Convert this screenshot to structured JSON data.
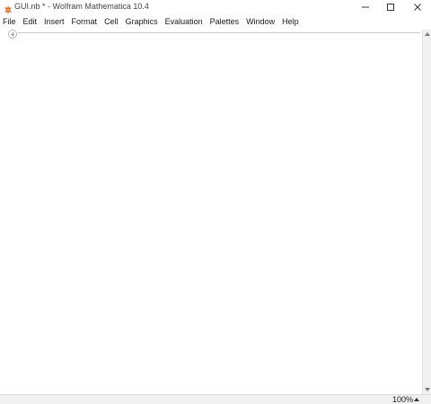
{
  "window": {
    "title": "GUI.nb * - Wolfram Mathematica 10.4",
    "icon": "mathematica-spiky-icon",
    "accent_color": "#e8591a"
  },
  "menubar": {
    "items": [
      "File",
      "Edit",
      "Insert",
      "Format",
      "Cell",
      "Graphics",
      "Evaluation",
      "Palettes",
      "Window",
      "Help"
    ]
  },
  "notebook": {
    "cell_insertion_icon": "plus-circle-icon"
  },
  "statusbar": {
    "zoom": "100%",
    "zoom_menu_icon": "caret-up-icon"
  }
}
